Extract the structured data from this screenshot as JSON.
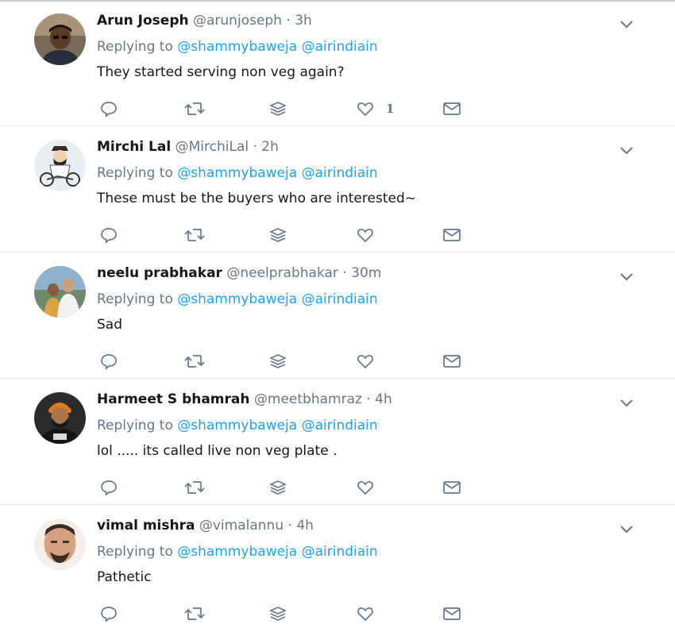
{
  "tweets": [
    {
      "name": "Arun Joseph",
      "handle": "@arunjoseph",
      "time": "3h",
      "replying_prefix": "Replying to",
      "mentions": [
        "@shammybaweja",
        "@airindiain"
      ],
      "text": "They started serving non veg again?",
      "like_count": "1",
      "avatar": "avatar-man-dark"
    },
    {
      "name": "Mirchi Lal",
      "handle": "@MirchiLal",
      "time": "2h",
      "replying_prefix": "Replying to",
      "mentions": [
        "@shammybaweja",
        "@airindiain"
      ],
      "text": "These must be the buyers who are interested~",
      "like_count": "",
      "avatar": "avatar-cartoon-rider"
    },
    {
      "name": "neelu prabhakar",
      "handle": "@neelprabhakar",
      "time": "30m",
      "replying_prefix": "Replying to",
      "mentions": [
        "@shammybaweja",
        "@airindiain"
      ],
      "text": "Sad",
      "like_count": "",
      "avatar": "avatar-couple"
    },
    {
      "name": "Harmeet S bhamrah",
      "handle": "@meetbhamraz",
      "time": "4h",
      "replying_prefix": "Replying to",
      "mentions": [
        "@shammybaweja",
        "@airindiain"
      ],
      "text": "lol ..... its called live non veg plate .",
      "like_count": "",
      "avatar": "avatar-turban"
    },
    {
      "name": "vimal mishra",
      "handle": "@vimalannu",
      "time": "4h",
      "replying_prefix": "Replying to",
      "mentions": [
        "@shammybaweja",
        "@airindiain"
      ],
      "text": "Pathetic",
      "like_count": "",
      "avatar": "avatar-man-face"
    }
  ],
  "separator": "·",
  "icons": [
    "reply-icon",
    "retweet-icon",
    "stack-icon",
    "heart-icon",
    "mail-icon",
    "chevron-down-icon"
  ],
  "colors": {
    "link": "#1da1f2",
    "muted": "#657786",
    "text": "#14171a",
    "divider": "#e6ecf0"
  }
}
